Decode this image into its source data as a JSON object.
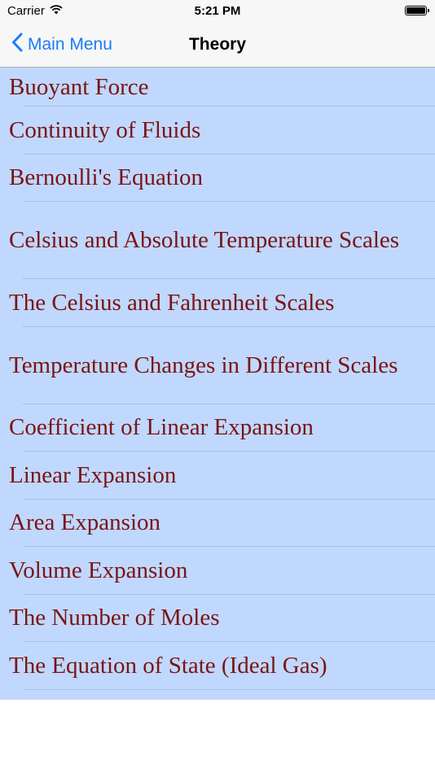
{
  "status_bar": {
    "carrier": "Carrier",
    "time": "5:21 PM",
    "wifi_icon": "wifi-icon",
    "battery_icon": "battery-icon"
  },
  "nav_bar": {
    "back_label": "Main Menu",
    "back_icon": "chevron-left-icon",
    "title": "Theory",
    "accent_color": "#1b7cf6"
  },
  "list": {
    "background_color": "#c0d8fe",
    "text_color": "#7a1414",
    "items": [
      {
        "label": "Buoyant Force"
      },
      {
        "label": "Continuity of Fluids"
      },
      {
        "label": "Bernoulli's Equation"
      },
      {
        "label": "Celsius and Absolute Temperature Scales"
      },
      {
        "label": "The Celsius and Fahrenheit Scales"
      },
      {
        "label": "Temperature Changes in Different Scales"
      },
      {
        "label": "Coefficient of Linear Expansion"
      },
      {
        "label": "Linear Expansion"
      },
      {
        "label": "Area Expansion"
      },
      {
        "label": "Volume Expansion"
      },
      {
        "label": "The Number of Moles"
      },
      {
        "label": "The Equation of State (Ideal Gas)"
      }
    ]
  }
}
